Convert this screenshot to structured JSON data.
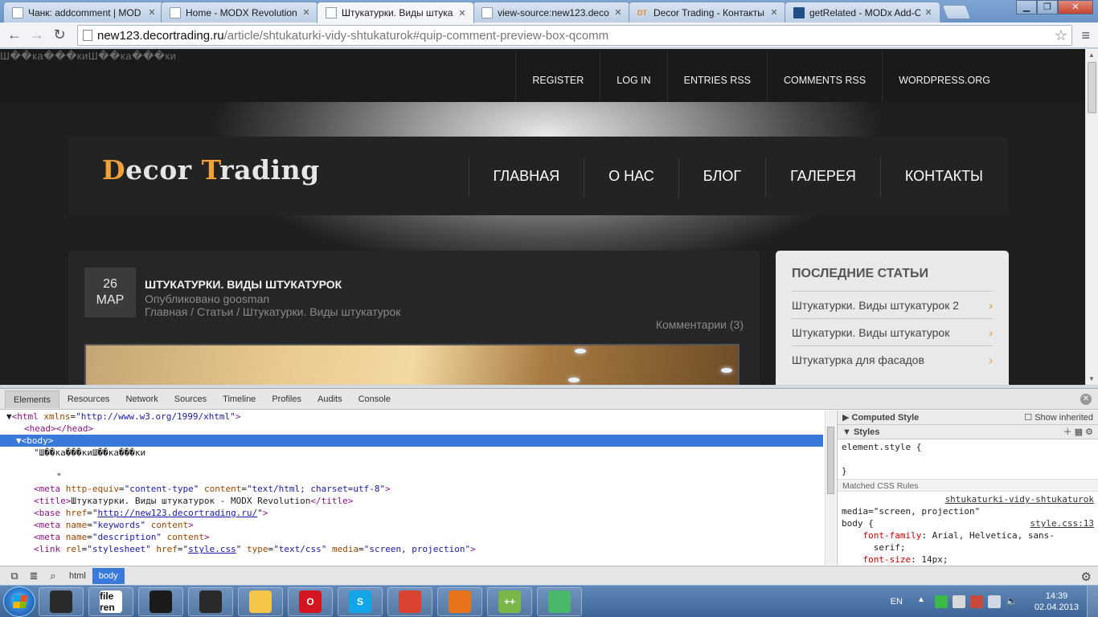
{
  "browser": {
    "tabs": [
      {
        "title": "Чанк: addcomment | MOD",
        "icon": "page-icon"
      },
      {
        "title": "Home - MODX Revolution",
        "icon": "page-icon"
      },
      {
        "title": "Штукатурки. Виды штука",
        "icon": "page-icon",
        "active": true
      },
      {
        "title": "view-source:new123.deco",
        "icon": "page-icon"
      },
      {
        "title": "Decor Trading - Контакты",
        "icon": "dt-icon",
        "icon_text": "DT"
      },
      {
        "title": "getRelated - MODx Add-O",
        "icon": "modx-icon"
      }
    ],
    "url_host": "new123.decortrading.ru",
    "url_path": "/article/shtukaturki-vidy-shtukaturok#quip-comment-preview-box-qcomm"
  },
  "page": {
    "garbled_text": "Ш��ка���киШ��ка���ки",
    "top_nav": [
      "REGISTER",
      "LOG IN",
      "ENTRIES RSS",
      "COMMENTS RSS",
      "WORDPRESS.ORG"
    ],
    "logo": {
      "d": "D",
      "ecor": "ecor ",
      "t": "T",
      "rading": "rading"
    },
    "main_nav": [
      "ГЛАВНАЯ",
      "О НАС",
      "БЛОГ",
      "ГАЛЕРЕЯ",
      "КОНТАКТЫ"
    ],
    "post": {
      "day": "26",
      "month": "MAP",
      "title": "ШТУКАТУРКИ. ВИДЫ ШТУКАТУРОК",
      "author": "Опубликовано goosman",
      "breadcrumb": "Главная / Статьи / Штукатурки. Виды штукатурок",
      "comments": "Комментарии (3)"
    },
    "sidebar": {
      "title": "ПОСЛЕДНИЕ СТАТЬИ",
      "items": [
        "Штукатурки. Виды штукатурок 2",
        "Штукатурки. Виды штукатурок",
        "Штукатурка для фасадов"
      ]
    }
  },
  "devtools": {
    "tabs": [
      "Elements",
      "Resources",
      "Network",
      "Sources",
      "Timeline",
      "Profiles",
      "Audits",
      "Console"
    ],
    "active_tab": "Elements",
    "dom": {
      "l1_tag_open": "<html ",
      "l1_attr": "xmlns",
      "l1_val": "\"http://www.w3.org/1999/xhtml\"",
      "l1_tag_close": ">",
      "l2": "<head></head>",
      "l3": "<body>",
      "l4": "\"Ш��ка���киШ��ка���ки",
      "l5": "\"",
      "meta1_a1": "http-equiv",
      "meta1_v1": "\"content-type\"",
      "meta1_a2": "content",
      "meta1_v2": "\"text/html; charset=utf-8\"",
      "title_text": "Штукатурки. Виды штукатурок - MODX Revolution",
      "base_href": "http://new123.decortrading.ru/",
      "meta2_name": "\"keywords\"",
      "meta3_name": "\"description\"",
      "link_href": "style.css",
      "link_type": "\"text/css\"",
      "link_media": "\"screen, projection\""
    },
    "styles": {
      "computed_label": "Computed Style",
      "show_inherited": "Show inherited",
      "styles_label": "Styles",
      "element_style": "element.style {",
      "close_brace": "}",
      "matched_label": "Matched CSS Rules",
      "rule_source": "shtukaturki-vidy-shtukaturok",
      "rule_media": "media=\"screen, projection\"",
      "selector": "body {",
      "file_link": "style.css:13",
      "prop1": "font-family",
      "val1": "Arial, Helvetica, sans-",
      "val1b": "serif;",
      "prop2": "font-size",
      "val2": "14px;"
    },
    "breadcrumbs": [
      "html",
      "body"
    ]
  },
  "taskbar": {
    "apps": [
      {
        "name": "cursor-tool",
        "label": "",
        "color": "#2a2a2a"
      },
      {
        "name": "file-renamer",
        "label": "file ren",
        "color": "#ffffff"
      },
      {
        "name": "film-app",
        "label": "",
        "color": "#1b1b1b"
      },
      {
        "name": "pointer-app",
        "label": "",
        "color": "#2a2a2a"
      },
      {
        "name": "explorer",
        "label": "",
        "color": "#f3c64a"
      },
      {
        "name": "opera",
        "label": "O",
        "color": "#d41620"
      },
      {
        "name": "skype",
        "label": "S",
        "color": "#12a5e8"
      },
      {
        "name": "chrome",
        "label": "",
        "color": "#d9432f"
      },
      {
        "name": "firefox",
        "label": "",
        "color": "#e7731b"
      },
      {
        "name": "notepad-plus",
        "label": "++",
        "color": "#7ab648"
      },
      {
        "name": "cup-app",
        "label": "",
        "color": "#49b86b"
      }
    ],
    "lang": "EN",
    "time": "14:39",
    "date": "02.04.2013"
  }
}
